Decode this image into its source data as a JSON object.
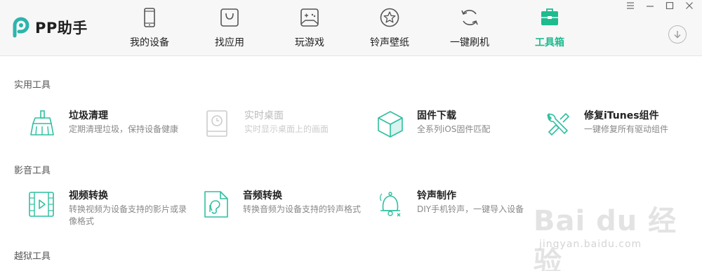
{
  "app": {
    "logo_text": "PP助手"
  },
  "nav": [
    {
      "label": "我的设备",
      "icon": "phone-icon",
      "active": false
    },
    {
      "label": "找应用",
      "icon": "app-bag-icon",
      "active": false
    },
    {
      "label": "玩游戏",
      "icon": "gamepad-icon",
      "active": false
    },
    {
      "label": "铃声壁纸",
      "icon": "star-icon",
      "active": false
    },
    {
      "label": "一键刷机",
      "icon": "refresh-icon",
      "active": false
    },
    {
      "label": "工具箱",
      "icon": "toolbox-icon",
      "active": true
    }
  ],
  "window_controls": [
    "menu-icon",
    "minimize-icon",
    "maximize-icon",
    "close-icon"
  ],
  "colors": {
    "accent": "#1dbb8e",
    "icon_teal": "#2fbfa0",
    "disabled": "#cccccc"
  },
  "sections": [
    {
      "title": "实用工具",
      "tools": [
        {
          "name": "垃圾清理",
          "desc": "定期清理垃圾，保持设备健康",
          "icon": "broom-icon",
          "enabled": true
        },
        {
          "name": "实时桌面",
          "desc": "实时显示桌面上的画面",
          "icon": "tablet-clock-icon",
          "enabled": false
        },
        {
          "name": "固件下载",
          "desc": "全系列iOS固件匹配",
          "icon": "cube-icon",
          "enabled": true
        },
        {
          "name": "修复iTunes组件",
          "desc": "一键修复所有驱动组件",
          "icon": "wrench-icon",
          "enabled": true
        }
      ]
    },
    {
      "title": "影音工具",
      "tools": [
        {
          "name": "视频转换",
          "desc": "转换视频为设备支持的影片或录像格式",
          "icon": "film-icon",
          "enabled": true
        },
        {
          "name": "音频转换",
          "desc": "转换音频为设备支持的铃声格式",
          "icon": "audio-file-icon",
          "enabled": true
        },
        {
          "name": "铃声制作",
          "desc": "DIY手机铃声，一键导入设备",
          "icon": "bell-icon",
          "enabled": true
        }
      ]
    },
    {
      "title": "越狱工具",
      "tools": []
    }
  ],
  "watermark": {
    "main": "Bai du 经验",
    "sub": "jingyan.baidu.com"
  }
}
